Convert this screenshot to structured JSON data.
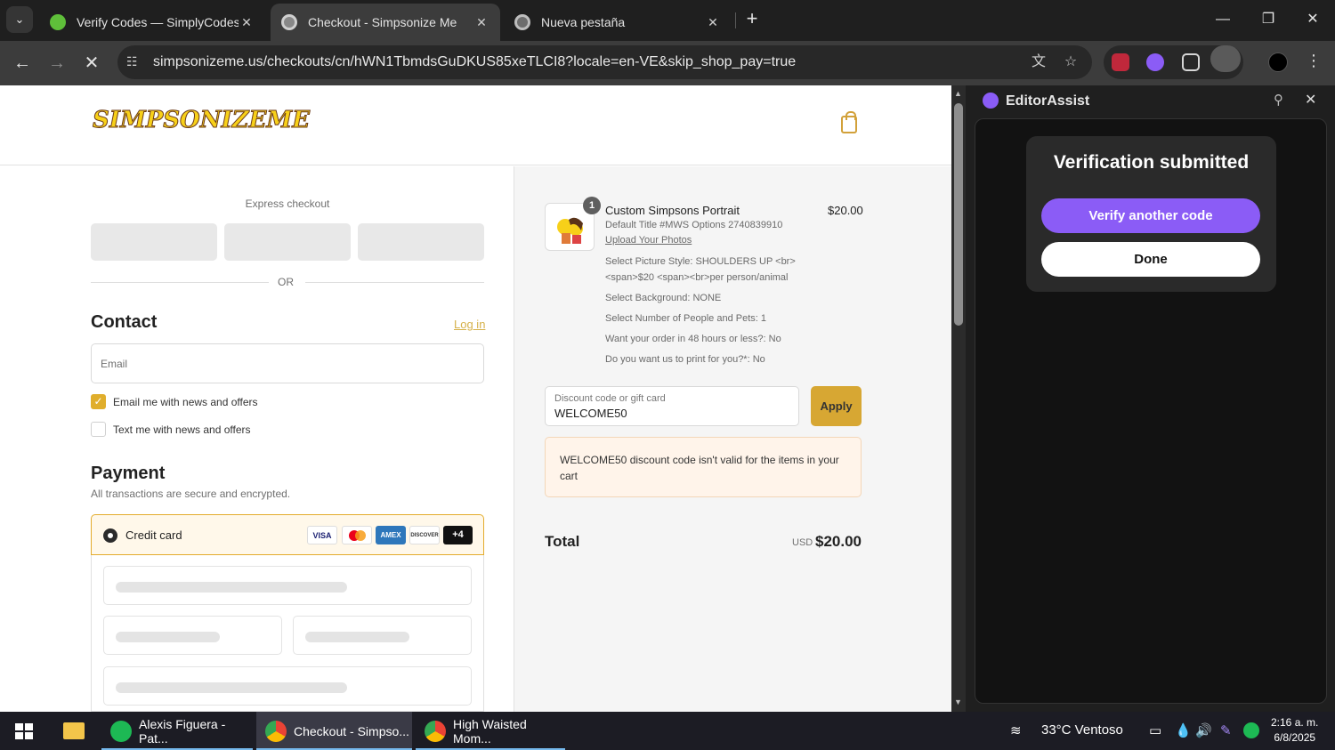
{
  "browser": {
    "tabs": [
      {
        "title": "Verify Codes — SimplyCodes",
        "active": false
      },
      {
        "title": "Checkout - Simpsonize Me",
        "active": true
      },
      {
        "title": "Nueva pestaña",
        "active": false
      }
    ],
    "url": "simpsonizeme.us/checkouts/cn/hWN1TbmdsGuDKUS85xeTLCI8?locale=en-VE&skip_shop_pay=true"
  },
  "store": {
    "logo_text": "SIMPSONIZEME"
  },
  "checkout": {
    "express_title": "Express checkout",
    "or": "OR",
    "contact_heading": "Contact",
    "login_link": "Log in",
    "email_placeholder": "Email",
    "email_news": "Email me with news and offers",
    "text_news": "Text me with news and offers",
    "payment_heading": "Payment",
    "payment_sub": "All transactions are secure and encrypted.",
    "credit_card": "Credit card",
    "cards": {
      "visa": "VISA",
      "amex": "AMEX",
      "discover": "DISCOVER",
      "more": "+4"
    }
  },
  "summary": {
    "quantity": "1",
    "product_name": "Custom Simpsons Portrait",
    "price": "$20.00",
    "meta": [
      "Default Title #MWS Options 2740839910",
      "Upload Your Photos",
      "Select Picture Style: SHOULDERS UP <br>",
      "<span>$20 <span><br>per person/animal",
      "Select Background: NONE",
      "Select Number of People and Pets: 1",
      "Want your order in 48 hours or less?: No",
      "Do you want us to print for you?*: No"
    ],
    "discount_label": "Discount code or gift card",
    "discount_value": "WELCOME50",
    "apply": "Apply",
    "error_code": "WELCOME50",
    "error_text": " discount code isn't valid for the items in your cart",
    "total_label": "Total",
    "currency": "USD",
    "total": "$20.00"
  },
  "side_panel": {
    "title": "EditorAssist",
    "status": "Verification submitted",
    "verify_another": "Verify another code",
    "done": "Done"
  },
  "taskbar": {
    "items": [
      {
        "label": "Alexis Figuera - Pat..."
      },
      {
        "label": "Checkout - Simpso..."
      },
      {
        "label": "High Waisted Mom..."
      }
    ],
    "weather": "33°C  Ventoso",
    "time": "2:16 a. m.",
    "date": "6/8/2025"
  },
  "colors": {
    "accent_gold": "#d7a733",
    "purple": "#8b5cf6",
    "error_bg": "#fff4ea"
  }
}
